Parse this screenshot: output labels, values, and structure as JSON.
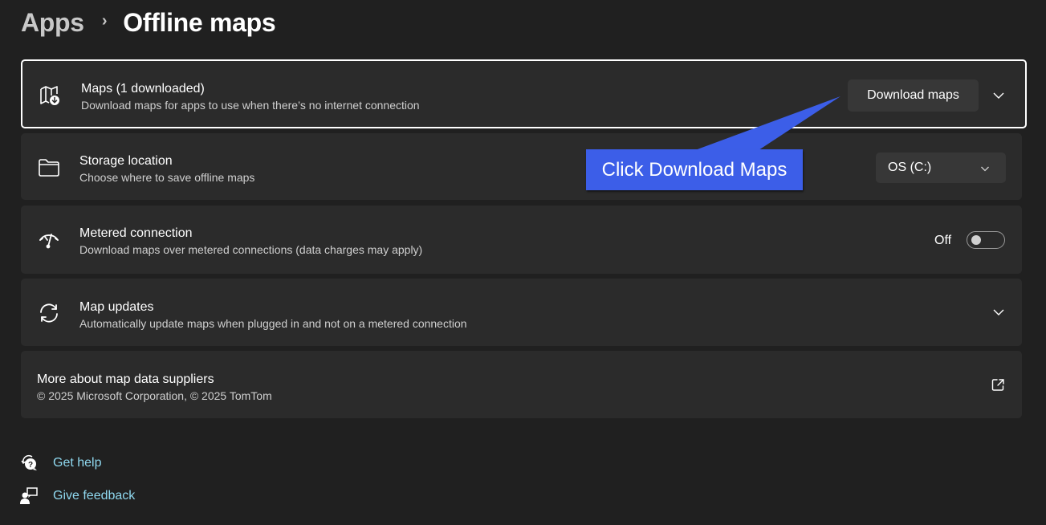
{
  "breadcrumb": {
    "parent": "Apps",
    "separator": "›",
    "current": "Offline maps"
  },
  "cards": {
    "maps": {
      "title": "Maps (1 downloaded)",
      "subtitle": "Download maps for apps to use when there’s no internet connection",
      "icon": "map-download-icon",
      "button_label": "Download maps",
      "expand_icon": "chevron-down-icon"
    },
    "storage": {
      "title": "Storage location",
      "subtitle": "Choose where to save offline maps",
      "icon": "folder-icon",
      "dropdown_value": "OS (C:)"
    },
    "metered": {
      "title": "Metered connection",
      "subtitle": "Download maps over metered connections (data charges may apply)",
      "icon": "metered-connection-icon",
      "toggle_label": "Off",
      "toggle_on": false
    },
    "updates": {
      "title": "Map updates",
      "subtitle": "Automatically update maps when plugged in and not on a metered connection",
      "icon": "sync-icon",
      "expand_icon": "chevron-down-icon"
    },
    "suppliers": {
      "title": "More about map data suppliers",
      "subtitle": "© 2025 Microsoft Corporation, © 2025 TomTom",
      "link_icon": "open-external-icon"
    }
  },
  "callout": {
    "text": "Click Download Maps",
    "color": "#3c5ee8"
  },
  "help": {
    "get_help": "Get help",
    "give_feedback": "Give feedback"
  },
  "colors": {
    "background": "#202020",
    "card": "#2b2b2b",
    "button": "#373737",
    "link": "#8fd8ef"
  }
}
